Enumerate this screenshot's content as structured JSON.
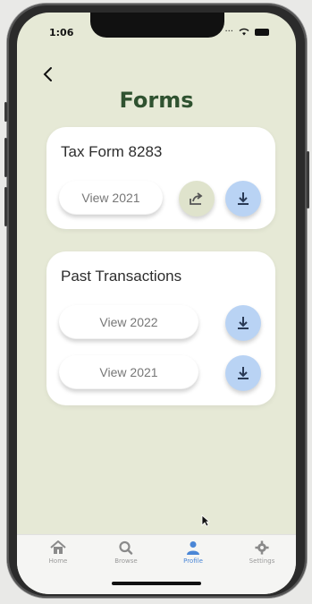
{
  "status_bar": {
    "time": "1:06"
  },
  "page": {
    "title": "Forms"
  },
  "cards": [
    {
      "title": "Tax Form 8283",
      "buttons": [
        {
          "label": "View 2021"
        }
      ]
    },
    {
      "title": "Past Transactions",
      "buttons": [
        {
          "label": "View 2022"
        },
        {
          "label": "View 2021"
        }
      ]
    }
  ],
  "tabbar": {
    "items": [
      {
        "label": "Home",
        "icon": "home-icon"
      },
      {
        "label": "Browse",
        "icon": "search-icon"
      },
      {
        "label": "Profile",
        "icon": "profile-icon",
        "active": true
      },
      {
        "label": "Settings",
        "icon": "gear-icon"
      }
    ]
  },
  "colors": {
    "background": "#e6e9d6",
    "title": "#2f5230",
    "accent": "#4a86d6",
    "download": "#b9d3f4",
    "share": "#dfe3cc"
  }
}
